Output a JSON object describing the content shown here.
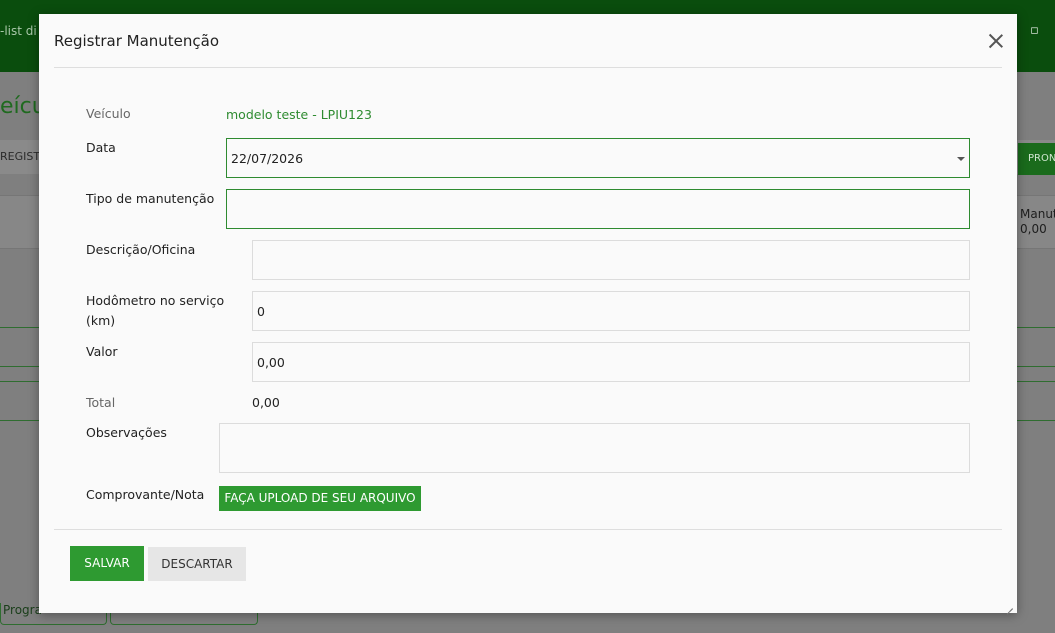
{
  "background": {
    "header_text": "-list di",
    "page_title": "eícul",
    "strip_left": "REGIST",
    "strip_right": "PRON",
    "table_right": [
      "Manut",
      "0,00"
    ],
    "bottom_btn": "Progra"
  },
  "modal": {
    "title": "Registrar Manutenção",
    "vehicle_label": "Veículo",
    "vehicle_value": "modelo teste - LPIU123",
    "date_label": "Data",
    "date_value": "22/07/2026",
    "type_label": "Tipo de manutenção",
    "type_value": "",
    "desc_label": "Descrição/Oficina",
    "desc_value": "",
    "odometer_label": "Hodômetro no serviço (km)",
    "odometer_value": "0",
    "value_label": "Valor",
    "value_value": "0,00",
    "total_label": "Total",
    "total_value": "0,00",
    "notes_label": "Observações",
    "notes_value": "",
    "receipt_label": "Comprovante/Nota",
    "upload_label": "FAÇA UPLOAD DE SEU ARQUIVO",
    "save_label": "SALVAR",
    "discard_label": "DESCARTAR"
  },
  "colors": {
    "accent": "#2e9a31",
    "link_green": "#2e8b30",
    "header_green": "#0a4d0d"
  },
  "icons": {
    "close": "close-icon",
    "dropdown": "chevron-down-icon",
    "resize": "resize-handle-icon",
    "notes": "note-icon"
  }
}
